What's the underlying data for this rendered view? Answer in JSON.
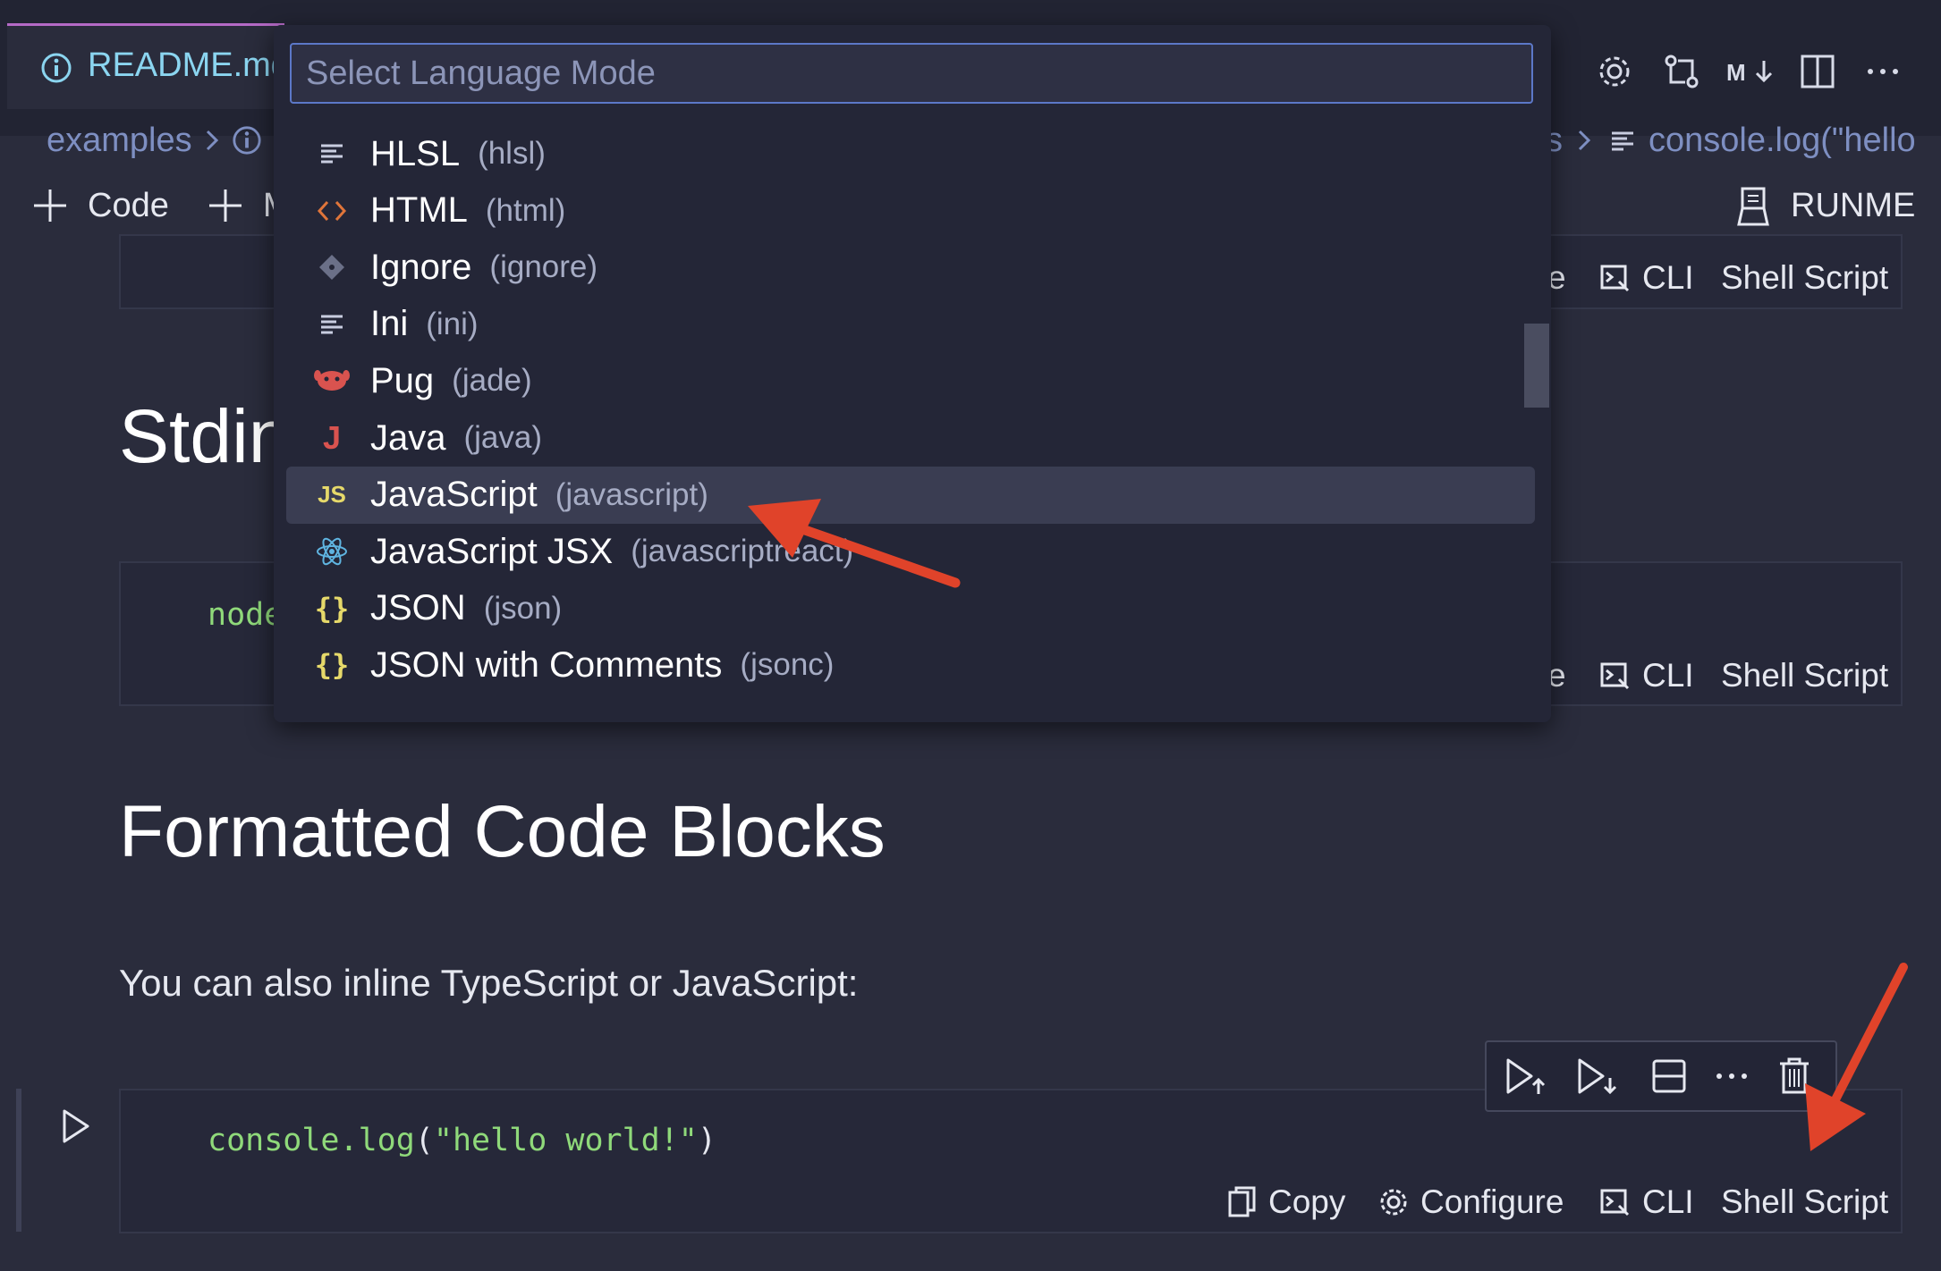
{
  "tab": {
    "label": "README.md"
  },
  "breadcrumb": {
    "left_item": "examples",
    "right_partial": "s",
    "right_item": "console.log(\"hello"
  },
  "toolbar": {
    "add_code_label": "Code",
    "add_markdown_label": "M",
    "runme_label": "RUNME"
  },
  "picker": {
    "placeholder": "Select Language Mode",
    "items": [
      {
        "label": "HLSL",
        "id": "(hlsl)",
        "icon": "lines-icon",
        "color": "#c9cde0"
      },
      {
        "label": "HTML",
        "id": "(html)",
        "icon": "html-icon",
        "color": "#e0753a"
      },
      {
        "label": "Ignore",
        "id": "(ignore)",
        "icon": "git-icon",
        "color": "#6b7088"
      },
      {
        "label": "Ini",
        "id": "(ini)",
        "icon": "lines-icon",
        "color": "#c9cde0"
      },
      {
        "label": "Pug",
        "id": "(jade)",
        "icon": "pug-icon",
        "color": "#d9534f"
      },
      {
        "label": "Java",
        "id": "(java)",
        "icon": "java-icon",
        "color": "#d9534f"
      },
      {
        "label": "JavaScript",
        "id": "(javascript)",
        "icon": "js-icon",
        "color": "#e6d96a",
        "selected": true
      },
      {
        "label": "JavaScript JSX",
        "id": "(javascriptreact)",
        "icon": "react-icon",
        "color": "#5fb4e0"
      },
      {
        "label": "JSON",
        "id": "(json)",
        "icon": "braces-icon",
        "color": "#e6d96a"
      },
      {
        "label": "JSON with Comments",
        "id": "(jsonc)",
        "icon": "braces-icon",
        "color": "#e6d96a"
      }
    ]
  },
  "cells": {
    "cell1_footer": {
      "partial": "e",
      "cli": "CLI",
      "shell": "Shell Script"
    },
    "stdin_heading": "Stdin",
    "cell2_code": "node",
    "cell2_footer": {
      "partial": "e",
      "cli": "CLI",
      "shell": "Shell Script"
    },
    "formatted_heading": "Formatted Code Blocks",
    "paragraph": "You can also inline TypeScript or JavaScript:",
    "cell3": {
      "code_fn": "console.log",
      "code_paren_open": "(",
      "code_str": "\"hello world!\"",
      "code_paren_close": ")",
      "copy": "Copy",
      "configure": "Configure",
      "cli": "CLI",
      "shell": "Shell Script"
    }
  },
  "colors": {
    "accent": "#e0432a",
    "code_green": "#8fd97a",
    "selection": "#3a3d52"
  }
}
